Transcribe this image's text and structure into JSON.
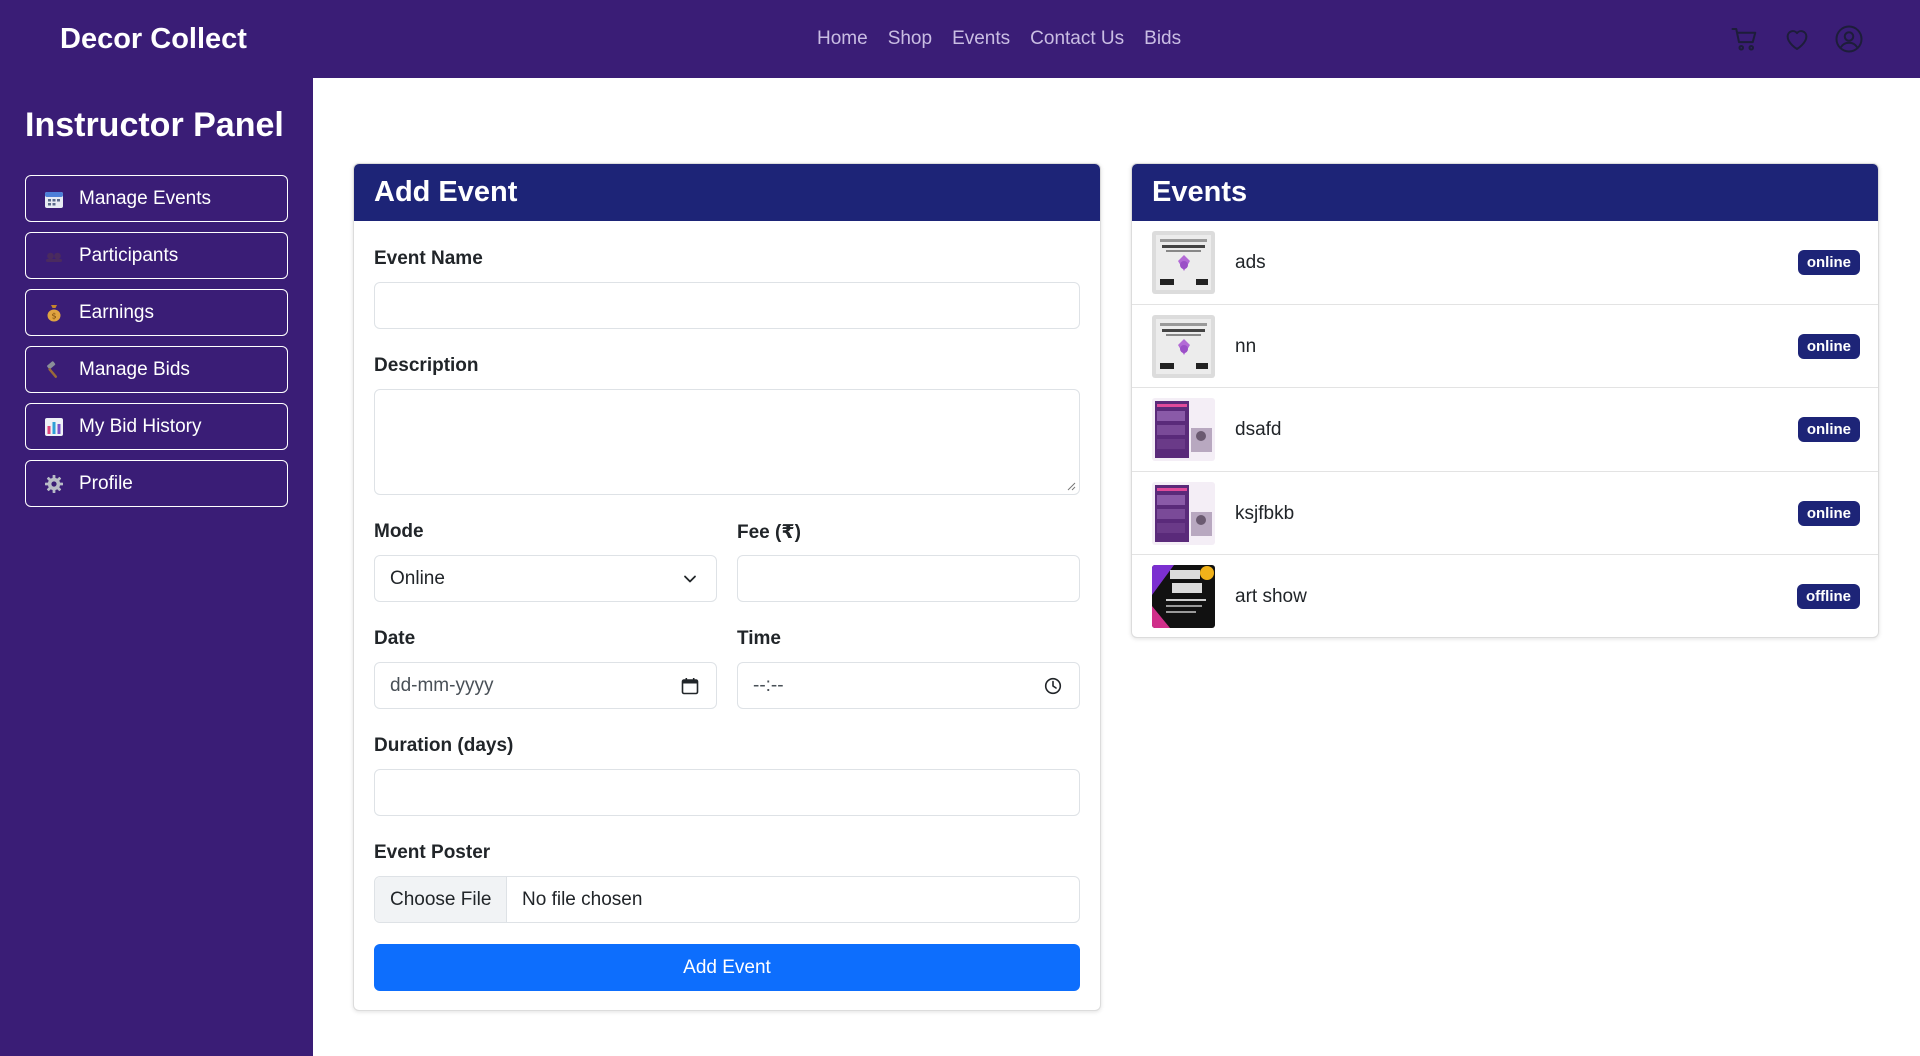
{
  "brand": "Decor Collect",
  "nav": [
    "Home",
    "Shop",
    "Events",
    "Contact Us",
    "Bids"
  ],
  "top_icons": [
    "cart-icon",
    "heart-icon",
    "user-circle-icon"
  ],
  "sidebar": {
    "title": "Instructor Panel",
    "items": [
      {
        "label": "Manage Events",
        "icon": "calendar-icon"
      },
      {
        "label": "Participants",
        "icon": "users-icon"
      },
      {
        "label": "Earnings",
        "icon": "money-bag-icon"
      },
      {
        "label": "Manage Bids",
        "icon": "hammer-icon"
      },
      {
        "label": "My Bid History",
        "icon": "bar-chart-icon"
      },
      {
        "label": "Profile",
        "icon": "gear-icon"
      }
    ]
  },
  "add_event": {
    "title": "Add Event",
    "event_name_label": "Event Name",
    "event_name_value": "",
    "description_label": "Description",
    "description_value": "",
    "mode_label": "Mode",
    "mode_value": "Online",
    "fee_label": "Fee (₹)",
    "fee_value": "",
    "date_label": "Date",
    "date_placeholder": "dd-mm-yyyy",
    "time_label": "Time",
    "time_placeholder": "--:--",
    "duration_label": "Duration (days)",
    "duration_value": "",
    "poster_label": "Event Poster",
    "choose_file_label": "Choose File",
    "no_file_text": "No file chosen",
    "submit_label": "Add Event"
  },
  "events": {
    "title": "Events",
    "items": [
      {
        "name": "ads",
        "status": "online"
      },
      {
        "name": "nn",
        "status": "online"
      },
      {
        "name": "dsafd",
        "status": "online"
      },
      {
        "name": "ksjfbkb",
        "status": "online"
      },
      {
        "name": "art show",
        "status": "offline"
      }
    ]
  },
  "colors": {
    "sidebar_bg": "#3a1d76",
    "card_header_bg": "#1d2477",
    "primary_button": "#0d6efd",
    "badge_bg": "#1d2477"
  }
}
